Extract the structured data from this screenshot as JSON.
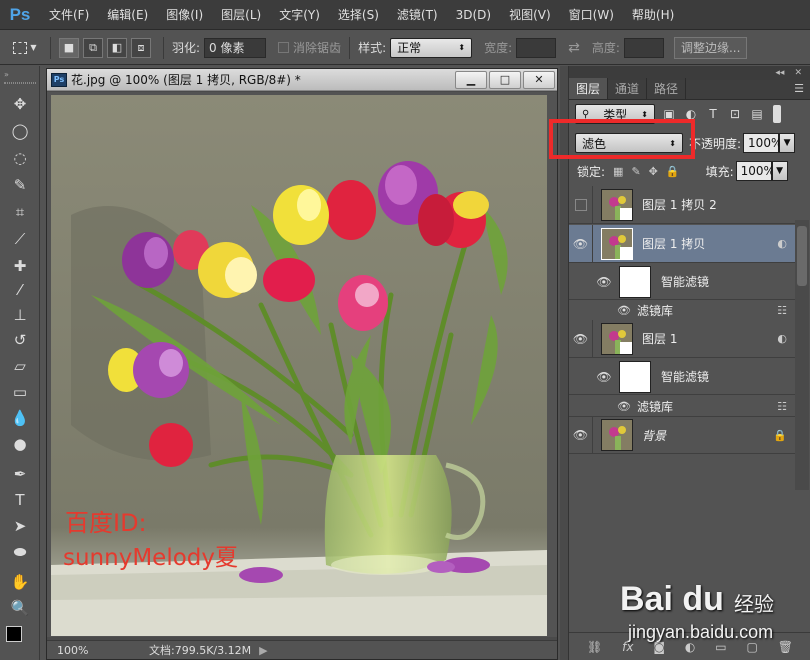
{
  "app": {
    "logo": "Ps"
  },
  "menu": [
    "文件(F)",
    "编辑(E)",
    "图像(I)",
    "图层(L)",
    "文字(Y)",
    "选择(S)",
    "滤镜(T)",
    "3D(D)",
    "视图(V)",
    "窗口(W)",
    "帮助(H)"
  ],
  "options": {
    "feather_label": "羽化:",
    "feather_value": "0 像素",
    "antialias_label": "消除锯齿",
    "style_label": "样式:",
    "style_value": "正常",
    "width_label": "宽度:",
    "height_label": "高度:",
    "refine_edge": "调整边缘..."
  },
  "document": {
    "title": "花.jpg @ 100% (图层 1 拷贝, RGB/8#) *",
    "zoom": "100%",
    "doc_info": "文档:799.5K/3.12M",
    "watermark_line1": "百度ID:",
    "watermark_line2": "sunnyMelody夏"
  },
  "layers_panel": {
    "tabs": [
      "图层",
      "通道",
      "路径"
    ],
    "filter_kind": "类型",
    "blend_mode": "滤色",
    "opacity_label": "不透明度:",
    "opacity_value": "100%",
    "lock_label": "锁定:",
    "fill_label": "填充:",
    "fill_value": "100%",
    "layers": [
      {
        "name": "图层 1 拷贝 2",
        "visible": false,
        "selected": false
      },
      {
        "name": "图层 1 拷贝",
        "visible": true,
        "selected": true,
        "smart_filter": "智能滤镜",
        "filter_name": "滤镜库"
      },
      {
        "name": "图层 1",
        "visible": true,
        "selected": false,
        "smart_filter": "智能滤镜",
        "filter_name": "滤镜库"
      },
      {
        "name": "背景",
        "visible": true,
        "selected": false,
        "locked": true
      }
    ]
  },
  "watermark": {
    "logo": "Bai du",
    "product": "经验",
    "url": "jingyan.baidu.com"
  },
  "colors": {
    "highlight": "#ee2a2a",
    "selected_layer": "#6b7b92",
    "watermark_text": "#e53a2e"
  }
}
